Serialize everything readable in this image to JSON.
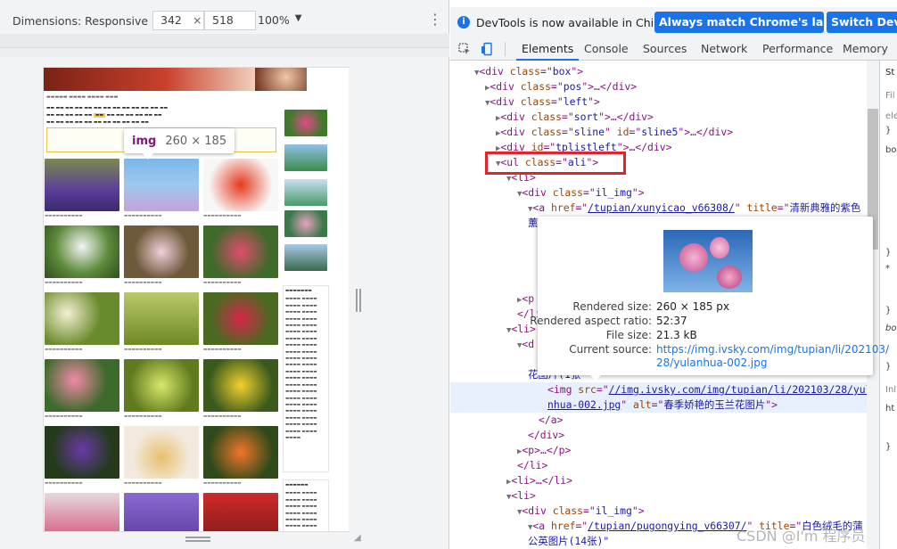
{
  "device_toolbar": {
    "dimensions_label": "Dimensions: Responsive",
    "width": "342",
    "times": "×",
    "height": "518",
    "zoom": "100%"
  },
  "page_preview": {
    "tooltip_tag": "img",
    "tooltip_size": "260 × 185"
  },
  "infobar": {
    "message": "DevTools is now available in Chinese!",
    "btn_match": "Always match Chrome's language",
    "btn_switch": "Switch DevTo"
  },
  "tabs": [
    "Elements",
    "Console",
    "Sources",
    "Network",
    "Performance",
    "Memory"
  ],
  "dom": {
    "r1_tag": "div",
    "r1_attr": "class",
    "r1_val": "box",
    "r2_tag": "div",
    "r2_attr": "class",
    "r2_val": "pos",
    "r3_tag": "div",
    "r3_attr": "class",
    "r3_val": "left",
    "r4_tag": "div",
    "r4_attr": "class",
    "r4_val": "sort",
    "r5_tag": "div",
    "r5_attr": "class",
    "r5_val": "sline",
    "r5_attr2": "id",
    "r5_val2": "sline5",
    "r6_tag": "div",
    "r6_attr": "id",
    "r6_val": "tplistleft",
    "r7_tag": "ul",
    "r7_attr": "class",
    "r7_val": "ali",
    "r8_tag": "li",
    "r9_tag": "div",
    "r9_attr": "class",
    "r9_val": "il_img",
    "r10_tag": "a",
    "r10_attr": "href",
    "r10_val": "/tupian/xunyicao_v66308/",
    "r10_attr2": "title",
    "r10_val2": "清新典雅的紫色",
    "r10_cont": "薰",
    "r14_tag": "p",
    "r15_close": "li",
    "r16_tag": "li",
    "r17_tag": "d",
    "r19_text": "花图片(1张",
    "r20_tag": "img",
    "r20_attr": "src",
    "r20_val": "//img.ivsky.com/img/tupian/li/202103/28/yula",
    "r20_val_cont": "nhua-002.jpg",
    "r20_attr2": "alt",
    "r20_val2": "春季娇艳的玉兰花图片",
    "r21_close": "a",
    "r22_close": "div",
    "r23_tag": "p",
    "r24_close": "li",
    "r25_tag": "li",
    "r26_tag": "li",
    "r27_tag": "div",
    "r27_attr": "class",
    "r27_val": "il_img",
    "r28_tag": "a",
    "r28_attr": "href",
    "r28_val": "/tupian/pugongying_v66307/",
    "r28_attr2": "title",
    "r28_val2": "白色绒毛的蒲",
    "r29_text": "公英图片(14张)\""
  },
  "image_tooltip": {
    "rendered_size_label": "Rendered size:",
    "rendered_size": "260 × 185 px",
    "aspect_label": "Rendered aspect ratio:",
    "aspect": "52:37",
    "filesize_label": "File size:",
    "filesize": "21.3 kB",
    "source_label": "Current source:",
    "source_1": "https://img.ivsky.com/img/tupian/li/202103/",
    "source_2": "28/yulanhua-002.jpg"
  },
  "styles_col": {
    "s1": "St",
    "s2": "Fil",
    "s3": "ele",
    "s4": "}",
    "s5": "bo",
    "s6": "}",
    "s7": "*",
    "s8": "}",
    "s9": "bo",
    "s10": "}",
    "s11": "Inl",
    "s12": "ht",
    "s13": "}"
  },
  "watermark": "CSDN @I'm 程序员"
}
